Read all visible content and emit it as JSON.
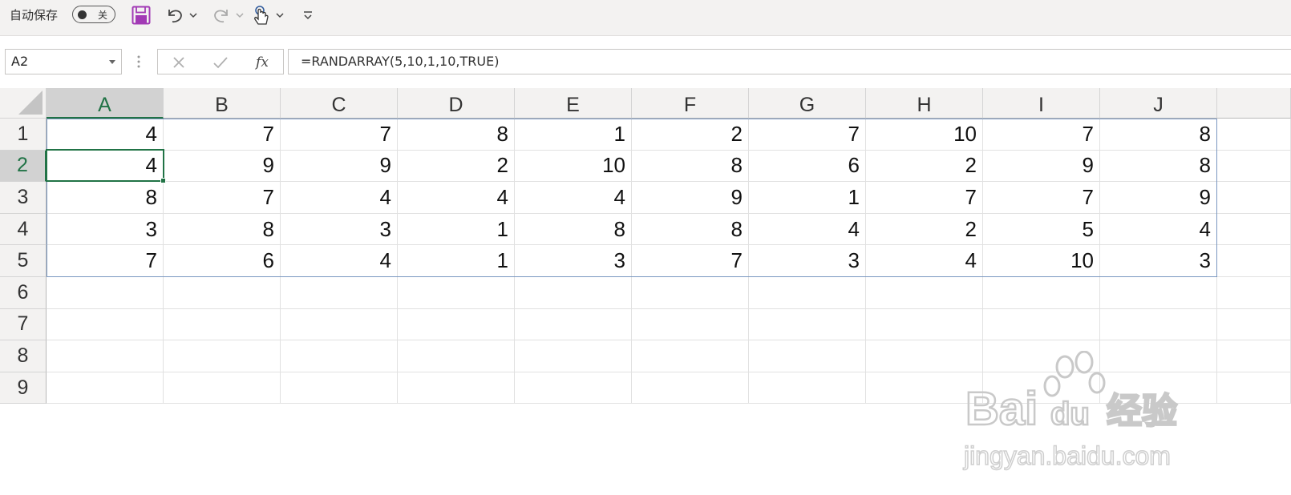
{
  "toolbar": {
    "autosave_label": "自动保存",
    "autosave_state": "关",
    "icons": [
      "save-icon",
      "undo-icon",
      "chevron-down-icon",
      "redo-icon",
      "chevron-down-icon",
      "touch-mode-icon",
      "chevron-down-icon",
      "customize-toolbar-icon"
    ]
  },
  "formula_bar": {
    "name_box": "A2",
    "formula": "=RANDARRAY(5,10,1,10,TRUE)",
    "fx_label": "fx"
  },
  "grid": {
    "columns": [
      "A",
      "B",
      "C",
      "D",
      "E",
      "F",
      "G",
      "H",
      "I",
      "J"
    ],
    "rows": [
      "1",
      "2",
      "3",
      "4",
      "5",
      "6",
      "7",
      "8",
      "9"
    ],
    "active_cell": "A2",
    "values": [
      [
        "4",
        "7",
        "7",
        "8",
        "1",
        "2",
        "7",
        "10",
        "7",
        "8"
      ],
      [
        "4",
        "9",
        "9",
        "2",
        "10",
        "8",
        "6",
        "2",
        "9",
        "8"
      ],
      [
        "8",
        "7",
        "4",
        "4",
        "4",
        "9",
        "1",
        "7",
        "7",
        "9"
      ],
      [
        "3",
        "8",
        "3",
        "1",
        "8",
        "8",
        "4",
        "2",
        "5",
        "4"
      ],
      [
        "7",
        "6",
        "4",
        "1",
        "3",
        "7",
        "3",
        "4",
        "10",
        "3"
      ]
    ]
  },
  "watermark": {
    "brand": "Bai du 经验",
    "url": "jingyan.baidu.com"
  },
  "colors": {
    "accent": "#217346",
    "spill_border": "#7a97c0",
    "header_bg": "#f3f2f1",
    "save_icon": "#a23ab5"
  }
}
